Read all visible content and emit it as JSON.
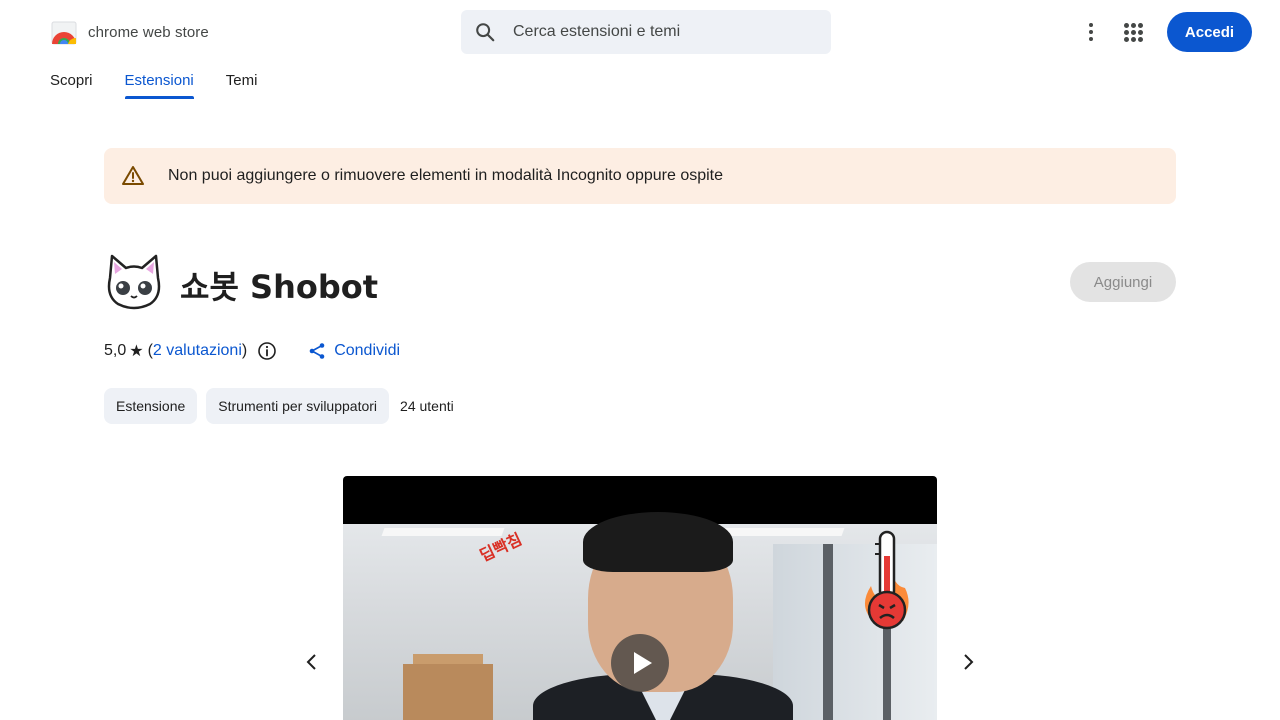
{
  "header": {
    "store_name": "chrome web store",
    "search_placeholder": "Cerca estensioni e temi",
    "signin_label": "Accedi"
  },
  "tabs": [
    {
      "label": "Scopri",
      "active": false
    },
    {
      "label": "Estensioni",
      "active": true
    },
    {
      "label": "Temi",
      "active": false
    }
  ],
  "banner": {
    "message": "Non puoi aggiungere o rimuovere elementi in modalità Incognito oppure ospite"
  },
  "extension": {
    "title": "쇼봇 Shobot",
    "add_label": "Aggiungi",
    "rating_value": "5,0",
    "rating_open": "(",
    "ratings_link": "2 valutazioni",
    "rating_close": ")",
    "share_label": "Condividi",
    "chips": [
      "Estensione",
      "Strumenti per sviluppatori"
    ],
    "users": "24 utenti"
  },
  "media": {
    "sticker_text": "딥빡침"
  },
  "colors": {
    "accent": "#0b57d0",
    "banner_bg": "#fdeee3",
    "chip_bg": "#eef1f6"
  },
  "icons": {
    "search": "search-icon",
    "more": "more-vert-icon",
    "apps": "apps-grid-icon",
    "warning": "warning-icon",
    "star": "star-icon",
    "info": "info-icon",
    "share": "share-icon",
    "prev": "chevron-left-icon",
    "next": "chevron-right-icon",
    "play": "play-icon"
  }
}
